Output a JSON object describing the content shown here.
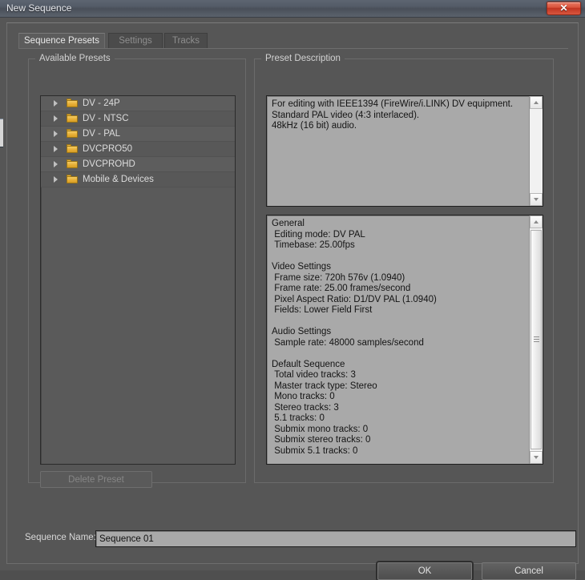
{
  "window": {
    "title": "New Sequence",
    "close_glyph": "✕"
  },
  "tabs": [
    {
      "label": "Sequence Presets",
      "active": true
    },
    {
      "label": "Settings",
      "active": false
    },
    {
      "label": "Tracks",
      "active": false
    }
  ],
  "available_presets": {
    "group_title": "Available Presets",
    "items": [
      {
        "label": "DV - 24P"
      },
      {
        "label": "DV - NTSC"
      },
      {
        "label": "DV - PAL"
      },
      {
        "label": "DVCPRO50"
      },
      {
        "label": "DVCPROHD"
      },
      {
        "label": "Mobile & Devices"
      }
    ],
    "delete_preset_label": "Delete Preset"
  },
  "preset_description": {
    "group_title": "Preset Description",
    "description": "For editing with IEEE1394 (FireWire/i.LINK) DV equipment.\nStandard PAL video (4:3 interlaced).\n48kHz (16 bit) audio.",
    "summary": "General\n Editing mode: DV PAL\n Timebase: 25.00fps\n\nVideo Settings\n Frame size: 720h 576v (1.0940)\n Frame rate: 25.00 frames/second\n Pixel Aspect Ratio: D1/DV PAL (1.0940)\n Fields: Lower Field First\n\nAudio Settings\n Sample rate: 48000 samples/second\n\nDefault Sequence\n Total video tracks: 3\n Master track type: Stereo\n Mono tracks: 0\n Stereo tracks: 3\n 5.1 tracks: 0\n Submix mono tracks: 0\n Submix stereo tracks: 0\n Submix 5.1 tracks: 0"
  },
  "sequence_name": {
    "label": "Sequence Name:",
    "value": "Sequence 01"
  },
  "footer": {
    "ok_label": "OK",
    "cancel_label": "Cancel"
  },
  "colors": {
    "dialog_background": "#565656",
    "titlebar": "#535b67",
    "close_button": "#d9513a",
    "text_pane_background": "#a9a9a9",
    "folder_icon": "#e6ae36"
  }
}
